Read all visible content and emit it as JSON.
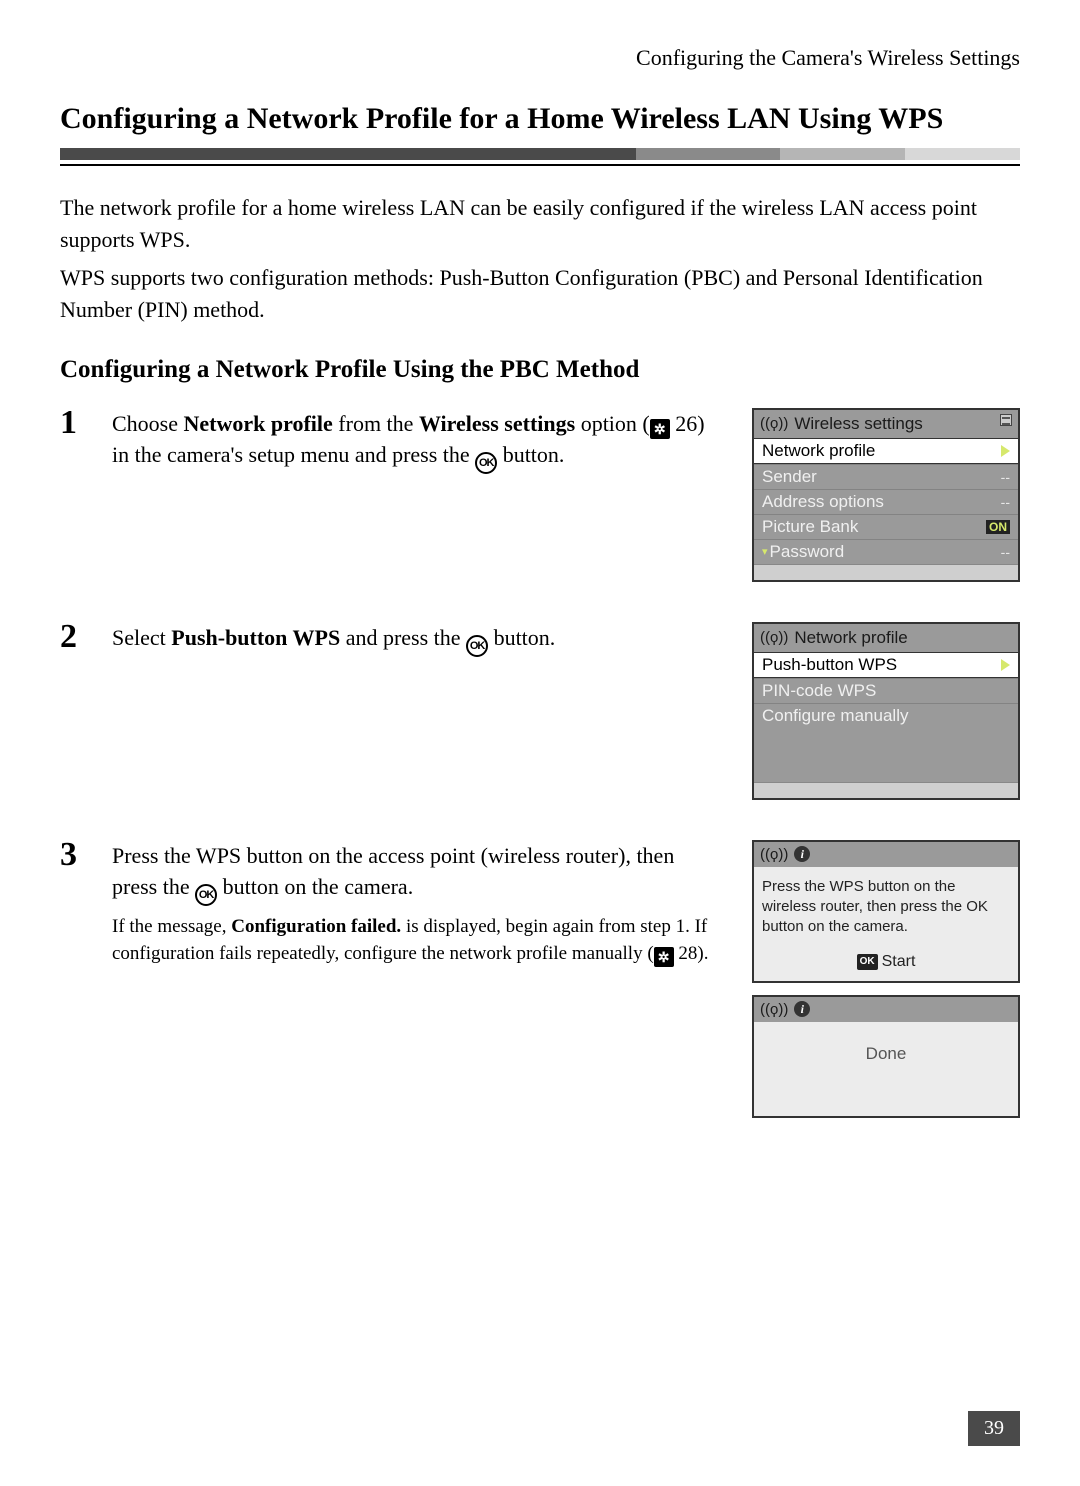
{
  "header": "Configuring the Camera's Wireless Settings",
  "title": "Configuring a Network Profile for a Home Wireless LAN Using WPS",
  "intro_p1": "The network profile for a home wireless LAN can be easily configured if the wireless LAN access point supports WPS.",
  "intro_p2": "WPS supports two configuration methods: Push-Button Configuration (PBC) and Personal Identification Number (PIN) method.",
  "subheading": "Configuring a Network Profile Using the PBC Method",
  "steps": {
    "s1": {
      "num": "1",
      "pre1": "Choose ",
      "bold1": "Network profile",
      "mid1": " from the ",
      "bold2": "Wireless settings",
      "mid2": " option (",
      "ref": "26",
      "mid3": ") in the camera's setup menu and press the ",
      "post": " button."
    },
    "s2": {
      "num": "2",
      "pre": "Select ",
      "bold": "Push-button WPS",
      "mid": " and press the ",
      "post": " button."
    },
    "s3": {
      "num": "3",
      "main_pre": "Press the WPS button on the access point (wireless router), then press the ",
      "main_post": " button on the camera.",
      "sub_pre": "If the message, ",
      "sub_bold": "Configuration failed.",
      "sub_mid": " is displayed, begin again from step 1. If configuration fails repeatedly, configure the network profile manually (",
      "sub_ref": "28",
      "sub_post": ")."
    }
  },
  "screen1": {
    "title": "Wireless settings",
    "rows": [
      {
        "label": "Network profile",
        "value": "--",
        "selected": true
      },
      {
        "label": "Sender",
        "value": "--"
      },
      {
        "label": "Address options",
        "value": "--"
      },
      {
        "label": "Picture Bank",
        "value": "ON",
        "on": true
      },
      {
        "label": "Password",
        "value": "--",
        "more": true
      }
    ]
  },
  "screen2": {
    "title": "Network profile",
    "rows": [
      {
        "label": "Push-button WPS",
        "selected": true
      },
      {
        "label": "PIN-code WPS"
      },
      {
        "label": "Configure manually"
      }
    ]
  },
  "screen3": {
    "body": "Press the WPS button on the wireless router, then press the OK button on the camera.",
    "start": "Start"
  },
  "screen4": {
    "done": "Done"
  },
  "page_number": "39"
}
